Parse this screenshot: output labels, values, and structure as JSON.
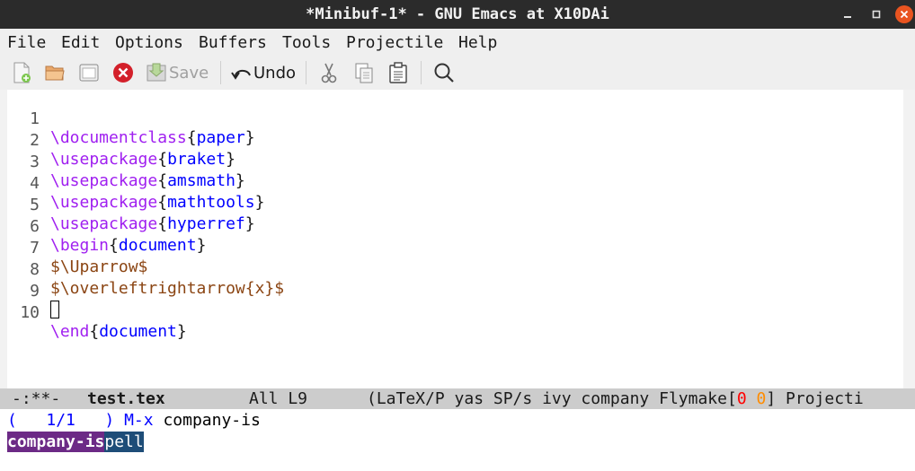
{
  "window": {
    "title": "*Minibuf-1* - GNU Emacs at X10DAi",
    "controls": [
      "minimize",
      "maximize",
      "close"
    ]
  },
  "menubar": [
    "File",
    "Edit",
    "Options",
    "Buffers",
    "Tools",
    "Projectile",
    "Help"
  ],
  "toolbar": {
    "save_label": "Save",
    "undo_label": "Undo",
    "icons": [
      "new-file-icon",
      "open-folder-icon",
      "dired-icon",
      "close-buffer-icon",
      "save-icon",
      "undo-icon",
      "cut-icon",
      "copy-icon",
      "paste-icon",
      "search-icon"
    ]
  },
  "editor": {
    "line_numbers": [
      "1",
      "2",
      "3",
      "4",
      "5",
      "6",
      "7",
      "8",
      "9",
      "10"
    ],
    "lines": [
      {
        "cmd": "\\documentclass",
        "open": "{",
        "arg": "paper",
        "close": "}"
      },
      {
        "cmd": "\\usepackage",
        "open": "{",
        "arg": "braket",
        "close": "}"
      },
      {
        "cmd": "\\usepackage",
        "open": "{",
        "arg": "amsmath",
        "close": "}"
      },
      {
        "cmd": "\\usepackage",
        "open": "{",
        "arg": "mathtools",
        "close": "}"
      },
      {
        "cmd": "\\usepackage",
        "open": "{",
        "arg": "hyperref",
        "close": "}"
      },
      {
        "cmd": "\\begin",
        "open": "{",
        "arg": "document",
        "close": "}"
      },
      {
        "math": "$\\Uparrow$"
      },
      {
        "math": "$\\overleftrightarrow{x}$"
      },
      {
        "cursor": true
      },
      {
        "cmd": "\\end",
        "open": "{",
        "arg": "document",
        "close": "}"
      }
    ]
  },
  "modeline": {
    "status": "-:**-",
    "buffer": "test.tex",
    "position": "All L9",
    "modes_prefix": "(LaTeX/P yas SP/s ivy company Flymake[",
    "flymake_errors": "0",
    "flymake_warnings": "0",
    "modes_suffix": "] Projecti",
    "colors": {
      "errors": "#ff0000",
      "warnings": "#ff8c00"
    }
  },
  "minibuffer": {
    "count_open": "(",
    "count": "1/1",
    "count_close": ")",
    "prompt": "M-x",
    "input": "company-is",
    "candidate_match": "company-is",
    "candidate_rest": "pell",
    "colors": {
      "match_bg": "#6c2a86",
      "rest_bg": "#1e4d78",
      "prompt": "#0000ff"
    }
  }
}
